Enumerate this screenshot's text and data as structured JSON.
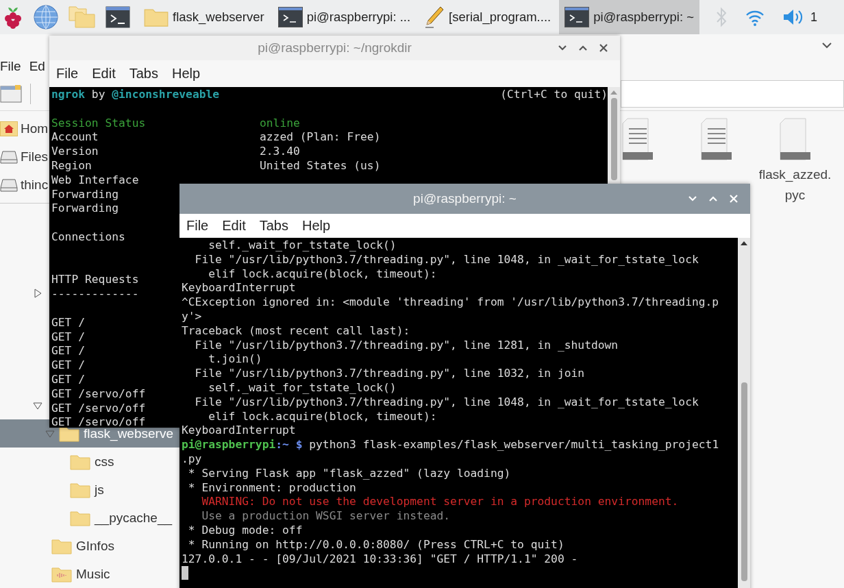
{
  "taskbar": {
    "launchers": [
      {
        "kind": "raspberry"
      },
      {
        "kind": "browser"
      },
      {
        "kind": "files"
      },
      {
        "kind": "terminal"
      }
    ],
    "tasks": [
      {
        "label": "flask_webserver",
        "kind": "folder",
        "selected": false
      },
      {
        "label": "pi@raspberrypi: ...",
        "kind": "terminal",
        "selected": false
      },
      {
        "label": "[serial_program....",
        "kind": "editor",
        "selected": false
      },
      {
        "label": "pi@raspberrypi: ~",
        "kind": "terminal",
        "selected": true
      }
    ],
    "tray": [
      {
        "kind": "bluetooth"
      },
      {
        "kind": "wifi"
      },
      {
        "kind": "volume"
      }
    ],
    "clock": "1"
  },
  "file_manager": {
    "menu": [
      "File",
      "Ed"
    ],
    "places": [
      {
        "label": "Hom",
        "kind": "home"
      },
      {
        "label": "Files",
        "kind": "drive"
      },
      {
        "label": "thinc",
        "kind": "drive"
      }
    ],
    "tree": [
      {
        "expanded": false
      },
      {
        "expanded": true,
        "children": [
          {
            "label": "flask_webserve",
            "kind": "folder",
            "selected": true,
            "expanded": true,
            "children": [
              {
                "label": "css",
                "kind": "folder",
                "selected": false
              },
              {
                "label": "js",
                "kind": "folder",
                "selected": false
              },
              {
                "label": "__pycache__",
                "kind": "folder",
                "selected": false
              }
            ]
          },
          {
            "label": "GInfos",
            "kind": "folder",
            "selected": false
          },
          {
            "label": "Music",
            "kind": "music",
            "selected": false
          }
        ]
      }
    ],
    "files": [
      {
        "kind": "text"
      },
      {
        "kind": "text"
      },
      {
        "label": "flask_azzed.pyc",
        "kind": "binary"
      }
    ]
  },
  "ngrok_window": {
    "title": "pi@raspberrypi: ~/ngrokdir",
    "menu": [
      "File",
      "Edit",
      "Tabs",
      "Help"
    ],
    "header": {
      "name": "ngrok",
      "by": "by",
      "author": "@inconshreveable",
      "hint": "(Ctrl+C to quit)"
    },
    "lines": [
      {
        "kind": "blank"
      },
      {
        "kind": "status",
        "label": "Session Status",
        "value": "online"
      },
      {
        "kind": "field",
        "label": "Account",
        "value": "azzed (Plan: Free)"
      },
      {
        "kind": "field",
        "label": "Version",
        "value": "2.3.40"
      },
      {
        "kind": "field",
        "label": "Region",
        "value": "United States (us)"
      },
      {
        "kind": "field",
        "label": "Web Interface"
      },
      {
        "kind": "field",
        "label": "Forwarding"
      },
      {
        "kind": "field",
        "label": "Forwarding"
      },
      {
        "kind": "blank"
      },
      {
        "kind": "field",
        "label": "Connections"
      },
      {
        "kind": "blank"
      },
      {
        "kind": "blank"
      },
      {
        "kind": "field",
        "label": "HTTP Requests"
      },
      {
        "kind": "field",
        "label": "-------------"
      },
      {
        "kind": "blank"
      },
      {
        "kind": "field",
        "label": "GET /"
      },
      {
        "kind": "field",
        "label": "GET /"
      },
      {
        "kind": "field",
        "label": "GET /"
      },
      {
        "kind": "field",
        "label": "GET /"
      },
      {
        "kind": "field",
        "label": "GET /"
      },
      {
        "kind": "field",
        "label": "GET /servo/off"
      },
      {
        "kind": "field",
        "label": "GET /servo/off"
      },
      {
        "kind": "field",
        "label": "GET /servo/off"
      }
    ]
  },
  "terminal_window": {
    "title": "pi@raspberrypi: ~",
    "menu": [
      "File",
      "Edit",
      "Tabs",
      "Help"
    ],
    "lines": [
      {
        "kind": "plain",
        "text": "    self._wait_for_tstate_lock()"
      },
      {
        "kind": "plain",
        "text": "  File \"/usr/lib/python3.7/threading.py\", line 1048, in _wait_for_tstate_lock"
      },
      {
        "kind": "plain",
        "text": "    elif lock.acquire(block, timeout):"
      },
      {
        "kind": "plain",
        "text": "KeyboardInterrupt"
      },
      {
        "kind": "plain",
        "text": "^CException ignored in: <module 'threading' from '/usr/lib/python3.7/threading.p"
      },
      {
        "kind": "plain",
        "text": "y'>"
      },
      {
        "kind": "plain",
        "text": "Traceback (most recent call last):"
      },
      {
        "kind": "plain",
        "text": "  File \"/usr/lib/python3.7/threading.py\", line 1281, in _shutdown"
      },
      {
        "kind": "plain",
        "text": "    t.join()"
      },
      {
        "kind": "plain",
        "text": "  File \"/usr/lib/python3.7/threading.py\", line 1032, in join"
      },
      {
        "kind": "plain",
        "text": "    self._wait_for_tstate_lock()"
      },
      {
        "kind": "plain",
        "text": "  File \"/usr/lib/python3.7/threading.py\", line 1048, in _wait_for_tstate_lock"
      },
      {
        "kind": "plain",
        "text": "    elif lock.acquire(block, timeout):"
      },
      {
        "kind": "plain",
        "text": "KeyboardInterrupt"
      },
      {
        "kind": "prompt",
        "user": "pi@raspberrypi",
        "path": ":~ $",
        "text": " python3 flask-examples/flask_webserver/multi_tasking_project1"
      },
      {
        "kind": "plain",
        "text": ".py"
      },
      {
        "kind": "plain",
        "text": " * Serving Flask app \"flask_azzed\" (lazy loading)"
      },
      {
        "kind": "plain",
        "text": " * Environment: production"
      },
      {
        "kind": "error",
        "text": "   WARNING: Do not use the development server in a production environment."
      },
      {
        "kind": "dim",
        "text": "   Use a production WSGI server instead."
      },
      {
        "kind": "plain",
        "text": " * Debug mode: off"
      },
      {
        "kind": "plain",
        "text": " * Running on http://0.0.0.0:8080/ (Press CTRL+C to quit)"
      },
      {
        "kind": "plain",
        "text": "127.0.0.1 - - [09/Jul/2021 10:33:36] \"GET / HTTP/1.1\" 200 -"
      },
      {
        "kind": "cursor"
      }
    ]
  }
}
